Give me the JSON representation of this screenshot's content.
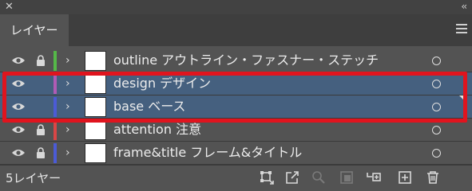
{
  "window": {
    "close_glyph": "✕",
    "collapse_glyph": "‹‹"
  },
  "panel": {
    "tab_label": "レイヤー",
    "menu_icon": "hamburger-menu-icon"
  },
  "layers": [
    {
      "name": "outline アウトライン・ファスナー・ステッチ",
      "color": "#55b848",
      "visible": true,
      "locked": true,
      "selected": false
    },
    {
      "name": "design デザイン",
      "color": "#b05bb5",
      "visible": true,
      "locked": false,
      "selected": true
    },
    {
      "name": "base ベース",
      "color": "#4b5bd6",
      "visible": true,
      "locked": false,
      "selected": true
    },
    {
      "name": "attention 注意",
      "color": "#d94646",
      "visible": true,
      "locked": true,
      "selected": false
    },
    {
      "name": "frame&title フレーム&タイトル",
      "color": "#4b5bd6",
      "visible": true,
      "locked": true,
      "selected": false
    }
  ],
  "footer": {
    "layer_count": "5レイヤー",
    "icons": [
      "collect-for-export-icon",
      "export-icon",
      "locate-object-icon",
      "make-clipping-mask-icon",
      "create-sublayer-icon",
      "new-layer-icon",
      "delete-icon"
    ]
  },
  "highlight_color": "#e0141e"
}
